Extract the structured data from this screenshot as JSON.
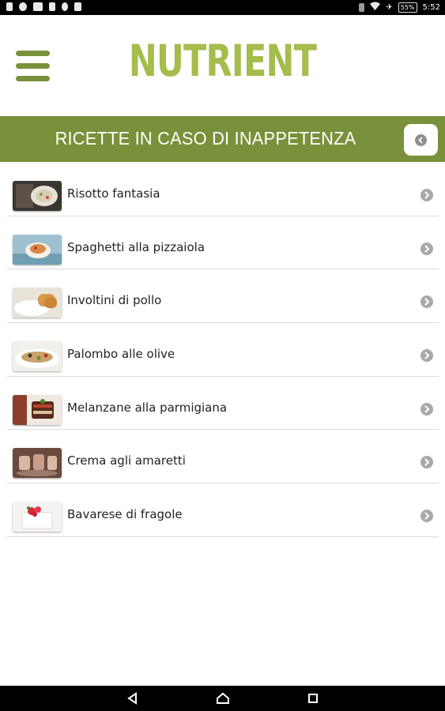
{
  "status_bar": {
    "time": "5:52",
    "battery": "55%",
    "left_icons": [
      "usb-icon",
      "android-icon",
      "image-icon",
      "usb-icon",
      "location-icon",
      "play-store-icon"
    ],
    "right_icons": [
      "vibrate-icon",
      "wifi-icon",
      "airplane-icon",
      "battery-icon"
    ]
  },
  "header": {
    "brand": "NUTRIENT",
    "menu_icon": "hamburger-menu-icon"
  },
  "section": {
    "title": "RICETTE IN CASO DI INAPPETENZA",
    "back_icon": "back-arrow-icon"
  },
  "recipes": [
    {
      "label": "Risotto fantasia",
      "thumb_icon": "risotto-thumbnail"
    },
    {
      "label": "Spaghetti alla pizzaiola",
      "thumb_icon": "spaghetti-thumbnail"
    },
    {
      "label": "Involtini di pollo",
      "thumb_icon": "involtini-thumbnail"
    },
    {
      "label": "Palombo alle olive",
      "thumb_icon": "palombo-thumbnail"
    },
    {
      "label": "Melanzane alla parmigiana",
      "thumb_icon": "melanzane-thumbnail"
    },
    {
      "label": "Crema agli amaretti",
      "thumb_icon": "crema-thumbnail"
    },
    {
      "label": "Bavarese di fragole",
      "thumb_icon": "bavarese-thumbnail"
    }
  ],
  "nav_bar": {
    "buttons": [
      "back-triangle-icon",
      "home-icon",
      "recents-icon"
    ]
  },
  "colors": {
    "accent_green": "#78913a",
    "brand_green": "#a4bd4c"
  }
}
